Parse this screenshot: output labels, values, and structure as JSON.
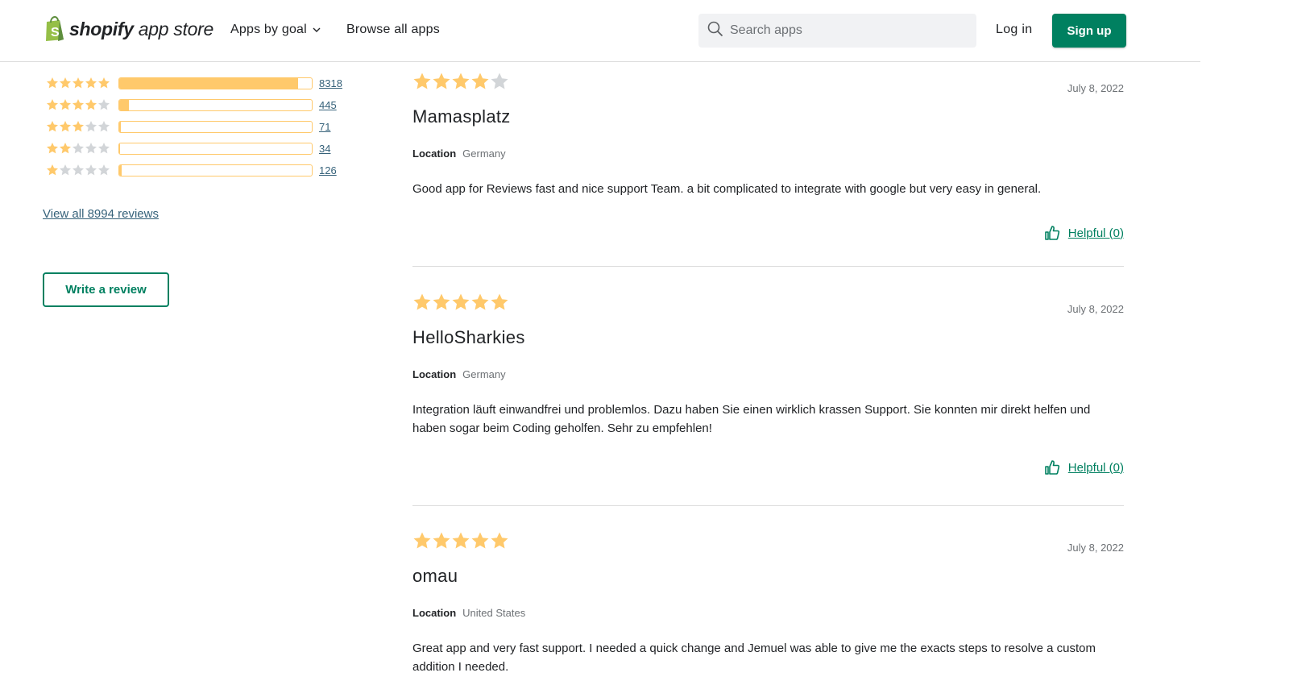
{
  "brand": {
    "logo_bold": "shopify",
    "logo_light": "app store",
    "logo_icon": "shopify-bag-icon",
    "accent": "#008060",
    "star_color": "#ffc96b"
  },
  "nav": {
    "apps_by_goal": "Apps by goal",
    "browse_all": "Browse all apps",
    "search_placeholder": "Search apps",
    "login": "Log in",
    "signup": "Sign up"
  },
  "summary": {
    "rows": [
      {
        "stars": 5,
        "count": "8318",
        "fill_fraction": 0.93
      },
      {
        "stars": 4,
        "count": "445",
        "fill_fraction": 0.05
      },
      {
        "stars": 3,
        "count": "71",
        "fill_fraction": 0.008
      },
      {
        "stars": 2,
        "count": "34",
        "fill_fraction": 0.004
      },
      {
        "stars": 1,
        "count": "126",
        "fill_fraction": 0.014
      }
    ],
    "view_all": "View all 8994 reviews",
    "write_review": "Write a review"
  },
  "reviews": [
    {
      "rating": 4,
      "date": "July 8, 2022",
      "author": "Mamasplatz",
      "location_label": "Location",
      "location": "Germany",
      "text": "Good app for Reviews fast and nice support Team. a bit complicated to integrate with google but very easy in general.",
      "helpful": "Helpful (0)"
    },
    {
      "rating": 5,
      "date": "July 8, 2022",
      "author": "HelloSharkies",
      "location_label": "Location",
      "location": "Germany",
      "text": "Integration läuft einwandfrei und problemlos. Dazu haben Sie einen wirklich krassen Support. Sie konnten mir direkt helfen und haben sogar beim Coding geholfen. Sehr zu empfehlen!",
      "helpful": "Helpful (0)"
    },
    {
      "rating": 5,
      "date": "July 8, 2022",
      "author": "omau",
      "location_label": "Location",
      "location": "United States",
      "text": "Great app and very fast support. I needed a quick change and Jemuel was able to give me the exacts steps to resolve a custom addition I needed."
    }
  ]
}
